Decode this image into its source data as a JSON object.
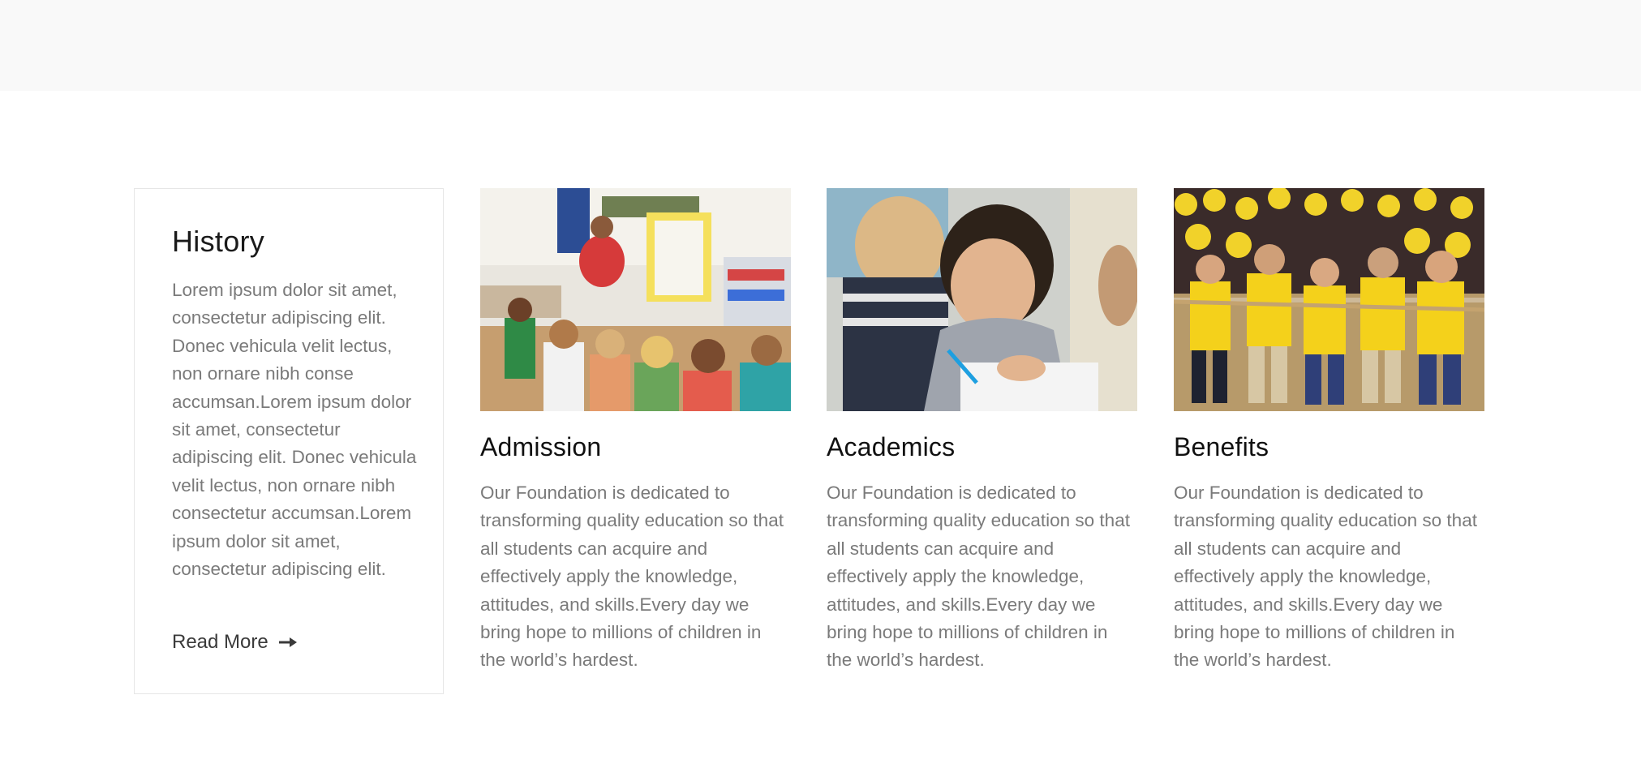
{
  "history": {
    "title": "History",
    "body": "Lorem ipsum dolor sit amet, consectetur adipiscing elit. Donec vehicula velit lectus, non ornare nibh conse accumsan.Lorem ipsum dolor sit amet, consectetur adipiscing elit. Donec vehicula velit lectus, non ornare nibh consectetur accumsan.Lorem ipsum dolor sit amet, consectetur adipiscing elit.",
    "read_more_label": "Read More",
    "read_more_icon": "arrow-right-icon"
  },
  "cards": [
    {
      "title": "Admission",
      "body": "Our Foundation is dedicated to transforming quality education so that all students can acquire and effectively apply the knowledge, attitudes, and skills.Every day we bring hope to millions of children in the world’s hardest."
    },
    {
      "title": "Academics",
      "body": "Our Foundation is dedicated to transforming quality education so that all students can acquire and effectively apply the knowledge, attitudes, and skills.Every day we bring hope to millions of children in the world’s hardest."
    },
    {
      "title": "Benefits",
      "body": "Our Foundation is dedicated to transforming quality education so that all students can acquire and effectively apply the knowledge, attitudes, and skills.Every day we bring hope to millions of children in the world’s hardest."
    }
  ],
  "colors": {
    "top_band": "#f9f9f9",
    "heading": "#111111",
    "body_text": "#7a7a7a",
    "card_border": "#e6e6e6"
  }
}
